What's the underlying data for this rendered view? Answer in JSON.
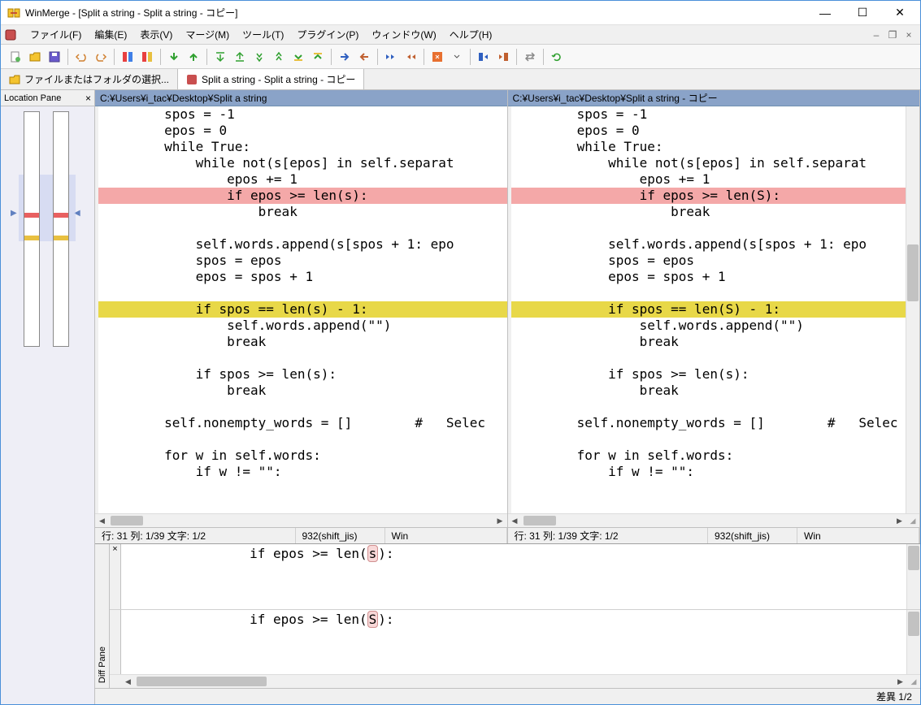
{
  "title": "WinMerge - [Split a string - Split a string - コピー]",
  "menu": [
    "ファイル(F)",
    "編集(E)",
    "表示(V)",
    "マージ(M)",
    "ツール(T)",
    "プラグイン(P)",
    "ウィンドウ(W)",
    "ヘルプ(H)"
  ],
  "tabs": [
    {
      "label": "ファイルまたはフォルダの選択...",
      "active": false
    },
    {
      "label": "Split a string - Split a string - コピー",
      "active": true
    }
  ],
  "locpane_title": "Location Pane",
  "left": {
    "path": "C:¥Users¥i_tac¥Desktop¥Split a string",
    "lines": [
      {
        "t": "        spos = -1"
      },
      {
        "t": "        epos = 0"
      },
      {
        "t": "        while True:"
      },
      {
        "t": "            while not(s[epos] in self.separat"
      },
      {
        "t": "                epos += 1"
      },
      {
        "t": "                if epos >= len(s):",
        "c": "dl-red"
      },
      {
        "t": "                    break"
      },
      {
        "t": ""
      },
      {
        "t": "            self.words.append(s[spos + 1: epo"
      },
      {
        "t": "            spos = epos"
      },
      {
        "t": "            epos = spos + 1"
      },
      {
        "t": ""
      },
      {
        "t": "            if spos == len(s) - 1:",
        "c": "dl-yel"
      },
      {
        "t": "                self.words.append(\"\")"
      },
      {
        "t": "                break"
      },
      {
        "t": ""
      },
      {
        "t": "            if spos >= len(s):"
      },
      {
        "t": "                break"
      },
      {
        "t": ""
      },
      {
        "t": "        self.nonempty_words = []        #   Selec"
      },
      {
        "t": ""
      },
      {
        "t": "        for w in self.words:"
      },
      {
        "t": "            if w != \"\":"
      }
    ],
    "status": {
      "pos": "行: 31  列: 1/39  文字: 1/2",
      "enc": "932(shift_jis)",
      "eol": "Win"
    }
  },
  "right": {
    "path": "C:¥Users¥i_tac¥Desktop¥Split a string - コピー",
    "lines": [
      {
        "t": "        spos = -1"
      },
      {
        "t": "        epos = 0"
      },
      {
        "t": "        while True:"
      },
      {
        "t": "            while not(s[epos] in self.separat"
      },
      {
        "t": "                epos += 1"
      },
      {
        "t": "                if epos >= len(S):",
        "c": "dl-red"
      },
      {
        "t": "                    break"
      },
      {
        "t": ""
      },
      {
        "t": "            self.words.append(s[spos + 1: epo"
      },
      {
        "t": "            spos = epos"
      },
      {
        "t": "            epos = spos + 1"
      },
      {
        "t": ""
      },
      {
        "t": "            if spos == len(S) - 1:",
        "c": "dl-yel"
      },
      {
        "t": "                self.words.append(\"\")"
      },
      {
        "t": "                break"
      },
      {
        "t": ""
      },
      {
        "t": "            if spos >= len(s):"
      },
      {
        "t": "                break"
      },
      {
        "t": ""
      },
      {
        "t": "        self.nonempty_words = []        #   Selec"
      },
      {
        "t": ""
      },
      {
        "t": "        for w in self.words:"
      },
      {
        "t": "            if w != \"\":"
      }
    ],
    "status": {
      "pos": "行: 31  列: 1/39  文字: 1/2",
      "enc": "932(shift_jis)",
      "eol": "Win"
    }
  },
  "diff": {
    "top": "                if epos >= len(s):",
    "top_hl": "s",
    "bot": "                if epos >= len(S):",
    "bot_hl": "S"
  },
  "footer": "差異 1/2"
}
